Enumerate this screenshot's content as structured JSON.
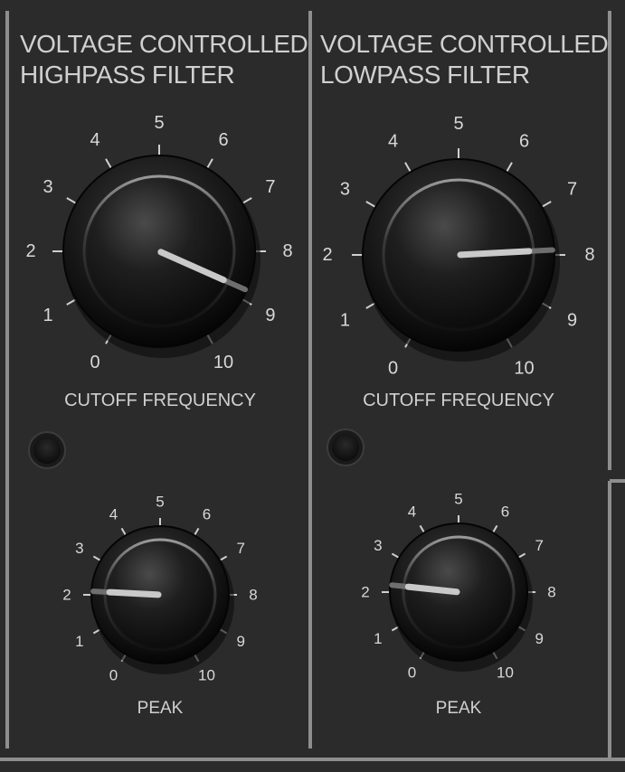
{
  "colors": {
    "panel": "#2b2b2b",
    "text": "#d0d0d0",
    "frame": "#8e8e8e",
    "knob_body": "#161616",
    "indicator": "#c9c9c9"
  },
  "modules": [
    {
      "title_line1": "VOLTAGE CONTROLLED",
      "title_line2": "HIGHPASS FILTER",
      "knobs": [
        {
          "label": "CUTOFF FREQUENCY",
          "value": 8.8,
          "scale": [
            "0",
            "1",
            "2",
            "3",
            "4",
            "5",
            "6",
            "7",
            "8",
            "9",
            "10"
          ]
        },
        {
          "label": "PEAK",
          "value": 2.1,
          "scale": [
            "0",
            "1",
            "2",
            "3",
            "4",
            "5",
            "6",
            "7",
            "8",
            "9",
            "10"
          ]
        }
      ]
    },
    {
      "title_line1": "VOLTAGE CONTROLLED",
      "title_line2": "LOWPASS FILTER",
      "knobs": [
        {
          "label": "CUTOFF FREQUENCY",
          "value": 7.9,
          "scale": [
            "0",
            "1",
            "2",
            "3",
            "4",
            "5",
            "6",
            "7",
            "8",
            "9",
            "10"
          ]
        },
        {
          "label": "PEAK",
          "value": 2.2,
          "scale": [
            "0",
            "1",
            "2",
            "3",
            "4",
            "5",
            "6",
            "7",
            "8",
            "9",
            "10"
          ]
        }
      ]
    }
  ]
}
